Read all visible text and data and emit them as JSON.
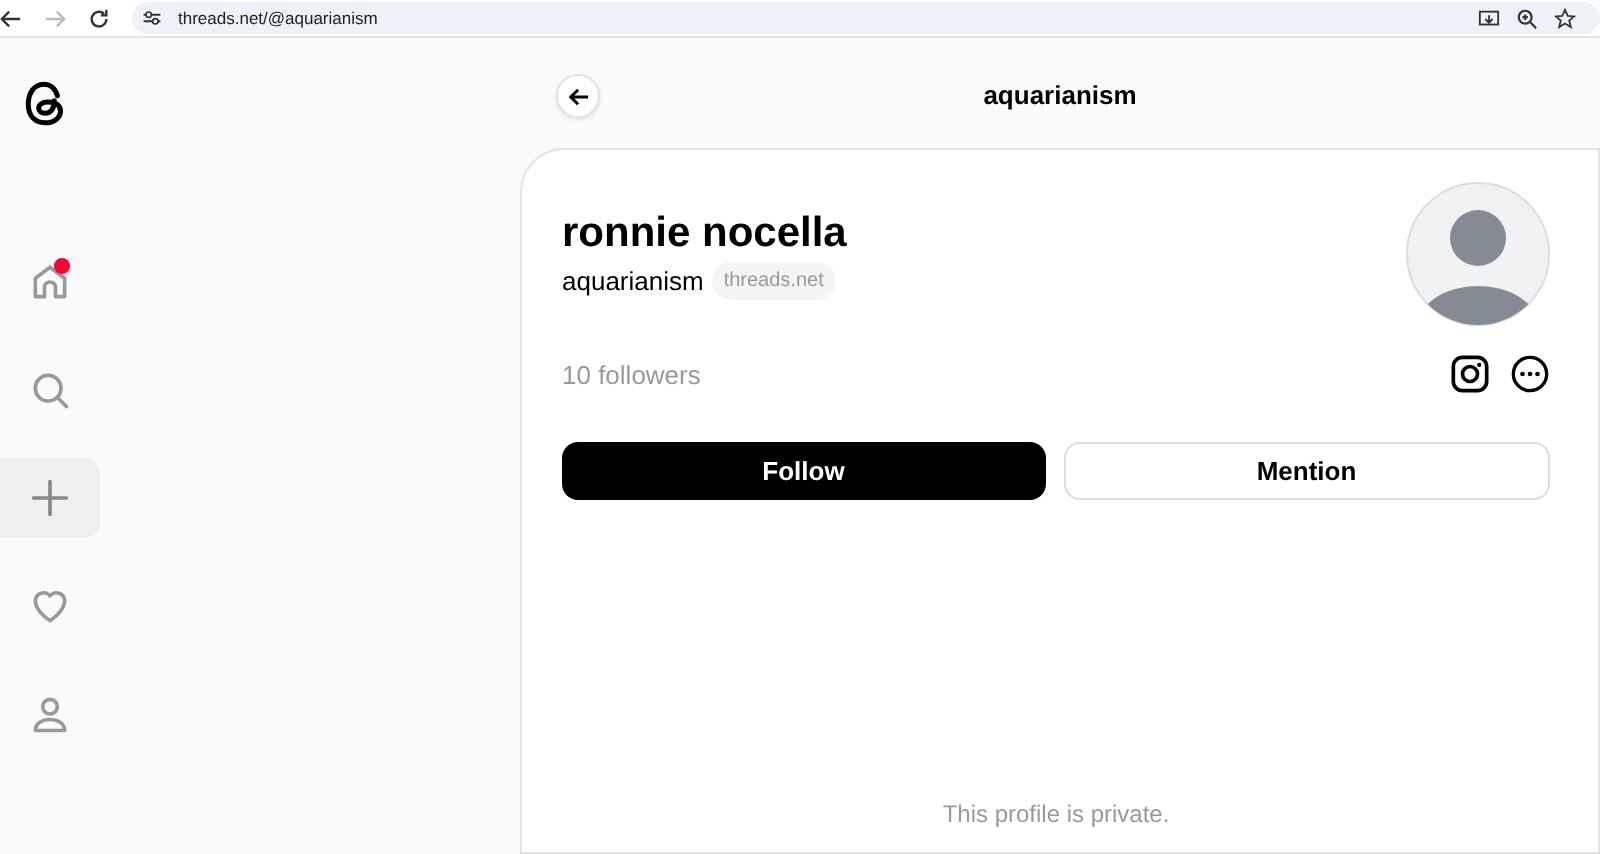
{
  "browser": {
    "url": "threads.net/@aquarianism",
    "back_disabled": false,
    "forward_disabled": true
  },
  "sidebar": {
    "items": [
      {
        "kind": "home",
        "notification": true
      },
      {
        "kind": "search",
        "notification": false
      },
      {
        "kind": "create",
        "notification": false
      },
      {
        "kind": "activity",
        "notification": false
      },
      {
        "kind": "profile",
        "notification": false
      }
    ]
  },
  "header": {
    "title": "aquarianism"
  },
  "profile": {
    "name": "ronnie nocella",
    "username": "aquarianism",
    "domain_badge": "threads.net",
    "followers": "10 followers",
    "follow_button": "Follow",
    "mention_button": "Mention",
    "private_notice": "This profile is private."
  }
}
